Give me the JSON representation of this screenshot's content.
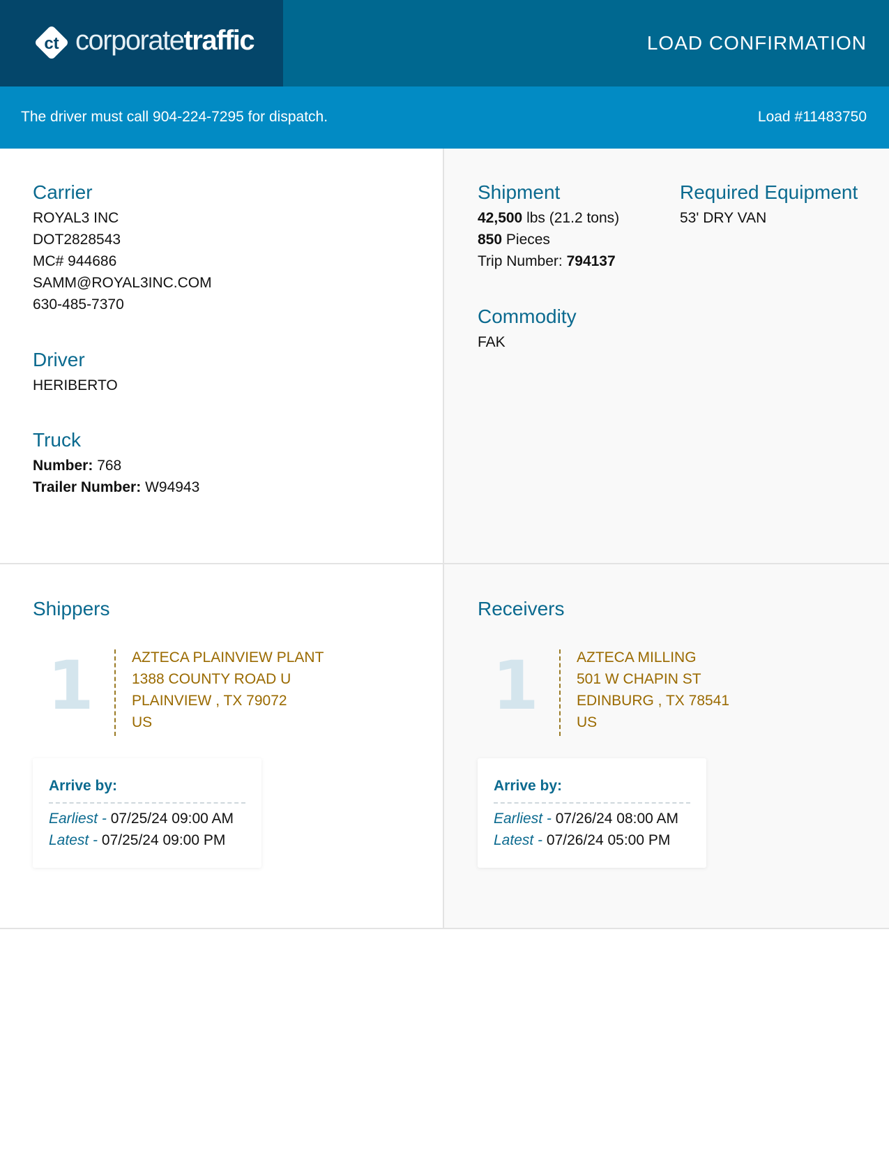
{
  "header": {
    "brand_light": "corporate",
    "brand_bold": "traffic",
    "logo_mark": "ct",
    "title": "LOAD CONFIRMATION"
  },
  "banner": {
    "dispatch": "The driver must call 904-224-7295 for dispatch.",
    "load": "Load #11483750"
  },
  "carrier": {
    "heading": "Carrier",
    "lines": [
      "ROYAL3 INC",
      "DOT2828543",
      "MC# 944686",
      "SAMM@ROYAL3INC.COM",
      "630-485-7370"
    ]
  },
  "driver": {
    "heading": "Driver",
    "name": "HERIBERTO"
  },
  "truck": {
    "heading": "Truck",
    "number_label": "Number:",
    "number": "768",
    "trailer_label": "Trailer Number:",
    "trailer": "W94943"
  },
  "shipment": {
    "heading": "Shipment",
    "weight": "42,500",
    "weight_unit": "lbs (21.2 tons)",
    "pieces": "850",
    "pieces_unit": "Pieces",
    "trip_label": "Trip Number:",
    "trip": "794137"
  },
  "equipment": {
    "heading": "Required Equipment",
    "value": "53' DRY VAN"
  },
  "commodity": {
    "heading": "Commodity",
    "value": "FAK"
  },
  "shippers": {
    "heading": "Shippers",
    "stop": "1",
    "address": [
      "AZTECA PLAINVIEW PLANT",
      "1388 COUNTY ROAD U",
      "PLAINVIEW , TX 79072",
      "US"
    ],
    "arrive_label": "Arrive by:",
    "earliest_label": "Earliest -",
    "earliest": "07/25/24 09:00 AM",
    "latest_label": "Latest -",
    "latest": "07/25/24 09:00 PM"
  },
  "receivers": {
    "heading": "Receivers",
    "stop": "1",
    "address": [
      "AZTECA MILLING",
      "501 W CHAPIN ST",
      "EDINBURG , TX 78541",
      "US"
    ],
    "arrive_label": "Arrive by:",
    "earliest_label": "Earliest -",
    "earliest": "07/26/24 08:00 AM",
    "latest_label": "Latest -",
    "latest": "07/26/24 05:00 PM"
  },
  "colors": {
    "brand_dark": "#04466a",
    "brand": "#006890",
    "banner": "#028bc4",
    "heading": "#0b6a8f",
    "address": "#9a6a00"
  }
}
